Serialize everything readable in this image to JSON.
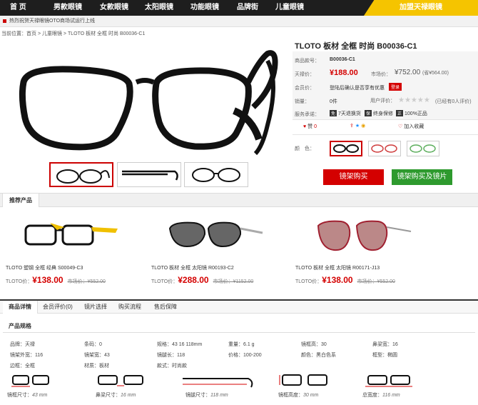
{
  "nav": {
    "items": [
      "首 页",
      "男款眼镜",
      "女款眼镜",
      "太阳眼镜",
      "功能眼镜",
      "品牌街",
      "儿童眼镜"
    ],
    "join": "加盟天禄眼镜"
  },
  "notice": "热烈祝贺天禄眼镜OTO商场试运行上线",
  "breadcrumb": "当前位置：首页 > 儿童眼镜 > TLOTO 板材 全框 时尚 B00036-C1",
  "product": {
    "title": "TLOTO 板材 全框 时尚 B00036-C1",
    "code_label": "商品款号：",
    "code": "B00036-C1",
    "price_label": "天禄价：",
    "price": "¥188.00",
    "market_label": "市场价：",
    "market_price": "¥752.00",
    "save": "(省¥564.00)",
    "member_label": "会员价：",
    "member_text": "登陆后确认是否享有优惠",
    "login": "登录",
    "sales_label": "销量：",
    "sales": "0件",
    "rating_label": "用户评价：",
    "stars": "★★★★★",
    "reviews": "(已经有0人评价)",
    "service_label": "服务承诺：",
    "services": [
      {
        "icon": "免",
        "text": "7天退换货"
      },
      {
        "icon": "保",
        "text": "终身保修"
      },
      {
        "icon": "正",
        "text": "100%正品"
      }
    ],
    "like": "赞",
    "like_count": "0",
    "fav": "加入收藏",
    "color_label": "颜　色：",
    "buy_frame": "镜架购买",
    "buy_frame_lens": "镜架购买及镜片"
  },
  "recommend": {
    "tab": "推荐产品",
    "items": [
      {
        "name": "TLOTO 塑钢 全框 经典 S00049-C3",
        "price_label": "TLOTO价：",
        "price": "¥138.00",
        "market": "市场价：¥552.00"
      },
      {
        "name": "TLOTO 板材 全框 太阳镜 R00193-C2",
        "price_label": "TLOTO价：",
        "price": "¥288.00",
        "market": "市场价：¥1152.00"
      },
      {
        "name": "TLOTO 板材 全框 太阳镜 R00171-J13",
        "price_label": "TLOTO价：",
        "price": "¥138.00",
        "market": "市场价：¥552.00"
      }
    ]
  },
  "tabs": [
    "商品详情",
    "会员评价(0)",
    "镜片选择",
    "购买流程",
    "售后保障"
  ],
  "specs": {
    "title": "产品规格",
    "rows": [
      [
        "品牌：天禄",
        "条码：0",
        "规格：43 16 118mm",
        "重量：6.1 g",
        "镜框高：30",
        "鼻梁宽：16"
      ],
      [
        "镜架外宽：116",
        "镜架宽：43",
        "镜腿长：118",
        "价格：100-200",
        "颜色：黑白色系",
        "框型：椭圆"
      ],
      [
        "边框：全框",
        "材质：板材",
        "款式：时尚款",
        "",
        "",
        ""
      ]
    ]
  },
  "dims": [
    {
      "label": "镜框尺寸：",
      "value": "43 mm"
    },
    {
      "label": "鼻梁尺寸：",
      "value": "16 mm"
    },
    {
      "label": "镜腿尺寸：",
      "value": "118 mm"
    },
    {
      "label": "镜框高度：",
      "value": "30 mm"
    },
    {
      "label": "总宽度：",
      "value": "116 mm"
    }
  ],
  "colors": {
    "accent": "#d40000",
    "green": "#2e9a2e",
    "nav": "#1e1e1e",
    "join": "#f5c400"
  }
}
